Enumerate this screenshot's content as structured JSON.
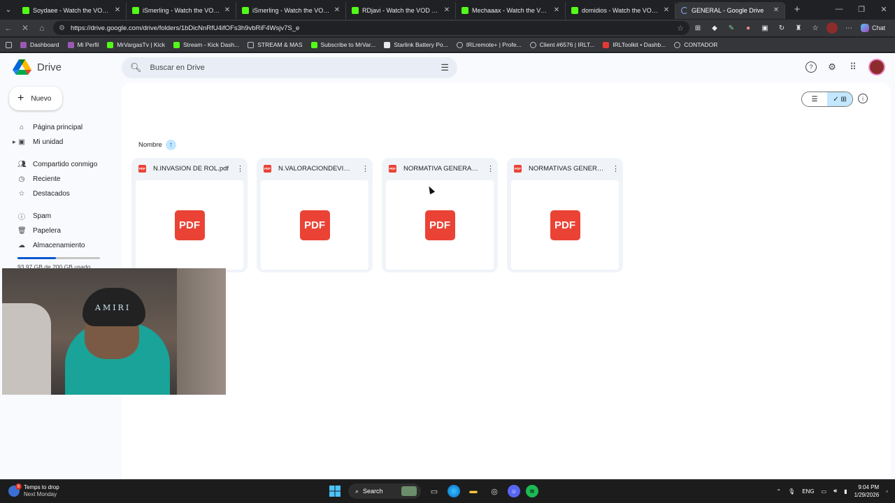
{
  "browser": {
    "tabs": [
      {
        "title": "Soydaee - Watch the VOD on Kick",
        "active": false
      },
      {
        "title": "iSmerling - Watch the VOD on Kick",
        "active": false
      },
      {
        "title": "iSmerling - Watch the VOD on Kick",
        "active": false
      },
      {
        "title": "RDjavi - Watch the VOD on Kick",
        "active": false
      },
      {
        "title": "Mechaaax - Watch the VOD on Kick",
        "active": false
      },
      {
        "title": "domidios - Watch the VOD on Kick",
        "active": false
      },
      {
        "title": "GENERAL - Google Drive",
        "active": true
      }
    ],
    "url": "https://drive.google.com/drive/folders/1bDicNnRfU4ifOFs3h9vbRiF4Wsjv7S_e",
    "chat_label": "Chat",
    "bookmarks": [
      "Dashboard",
      "Mi Perfil",
      "MrVargasTv | Kick",
      "Stream - Kick Dash...",
      "STREAM & MAS",
      "Subscribe to MrVar...",
      "Starlink Battery Po...",
      "IRLremote+ | Profe...",
      "Client #6576 | IRLT...",
      "IRLToolkit • Dashb...",
      "CONTADOR"
    ]
  },
  "drive": {
    "app_name": "Drive",
    "search_placeholder": "Buscar en Drive",
    "new_button": "Nuevo",
    "nav": {
      "home": "Página principal",
      "my_drive": "Mi unidad",
      "shared": "Compartido conmigo",
      "recent": "Reciente",
      "starred": "Destacados",
      "spam": "Spam",
      "trash": "Papelera",
      "storage": "Almacenamiento"
    },
    "storage_text": "93,97 GB de 200 GB usado",
    "storage_fraction": 0.47,
    "sort_label": "Nombre",
    "files": [
      {
        "name": "N.INVASION DE ROL.pdf",
        "thumb": "PDF"
      },
      {
        "name": "N.VALORACIONDEVIDA...",
        "thumb": "PDF"
      },
      {
        "name": "NORMATIVA GENERAL...",
        "thumb": "PDF"
      },
      {
        "name": "NORMATIVAS GENERAL...",
        "thumb": "PDF"
      }
    ]
  },
  "taskbar": {
    "weather_line1": "Temps to drop",
    "weather_line2": "Next Monday",
    "weather_badge": "8",
    "search_label": "Search",
    "lang": "ENG",
    "time": "9:04 PM",
    "date": "1/29/2026"
  },
  "webcam": {
    "cap_text": "AMIRI"
  },
  "colors": {
    "accent": "#0b57d0",
    "pdf_red": "#ea4335",
    "kick_green": "#53fc18",
    "toggle_bg": "#c2e7ff"
  }
}
